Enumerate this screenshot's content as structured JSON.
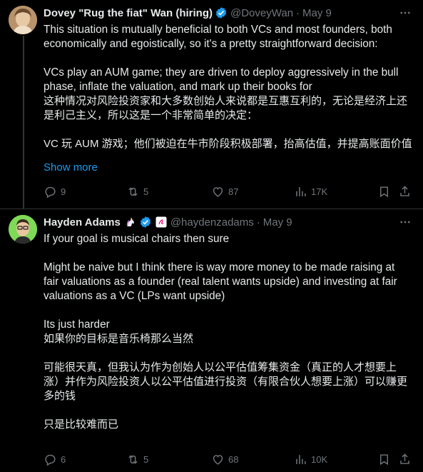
{
  "tweet1": {
    "display_name": "Dovey \"Rug the fiat\" Wan (hiring)",
    "handle": "@DoveyWan",
    "separator": "·",
    "date": "May 9",
    "lines": [
      "This situation is mutually beneficial to both VCs and most founders, both",
      "economically and egoistically, so it's a pretty straightforward decision:",
      "",
      "VCs play an AUM game; they are driven to deploy aggressively in the bull",
      "phase, inflate the valuation, and mark up their books for",
      "这种情况对风险投资家和大多数创始人来说都是互惠互利的，无论是经济上还",
      "是利己主义，所以这是一个非常简单的决定：",
      "",
      "VC 玩 AUM 游戏；他们被迫在牛市阶段积极部署，抬高估值，并提高账面价值"
    ],
    "show_more": "Show more",
    "replies": "9",
    "reposts": "5",
    "likes": "87",
    "views": "17K"
  },
  "tweet2": {
    "display_name": "Hayden Adams",
    "handle": "@haydenzadams",
    "separator": "·",
    "date": "May 9",
    "lines": [
      "If your goal is musical chairs then sure",
      "",
      "Might be naive but I think there is way more money to be made raising at",
      "fair valuations as a founder (real talent wants upside) and investing at fair",
      "valuations as a VC (LPs want upside)",
      "",
      "Its just harder",
      "如果你的目标是音乐椅那么当然",
      "",
      "可能很天真，但我认为作为创始人以公平估值筹集资金（真正的人才想要上",
      "涨）并作为风险投资人以公平估值进行投资（有限合伙人想要上涨）可以赚更",
      "多的钱",
      "",
      "只是比较难而已"
    ],
    "replies": "6",
    "reposts": "5",
    "likes": "68",
    "views": "10K"
  },
  "icons": [
    "verified-badge-icon",
    "unicorn-emoji-icon",
    "more-icon",
    "reply-icon",
    "repost-icon",
    "like-icon",
    "views-icon",
    "bookmark-icon",
    "share-icon"
  ],
  "colors": {
    "background": "#000000",
    "text": "#e7e9ea",
    "muted": "#71767b",
    "link": "#1d9bf0",
    "verified": "#1d9bf0",
    "divider": "#2f3336"
  }
}
